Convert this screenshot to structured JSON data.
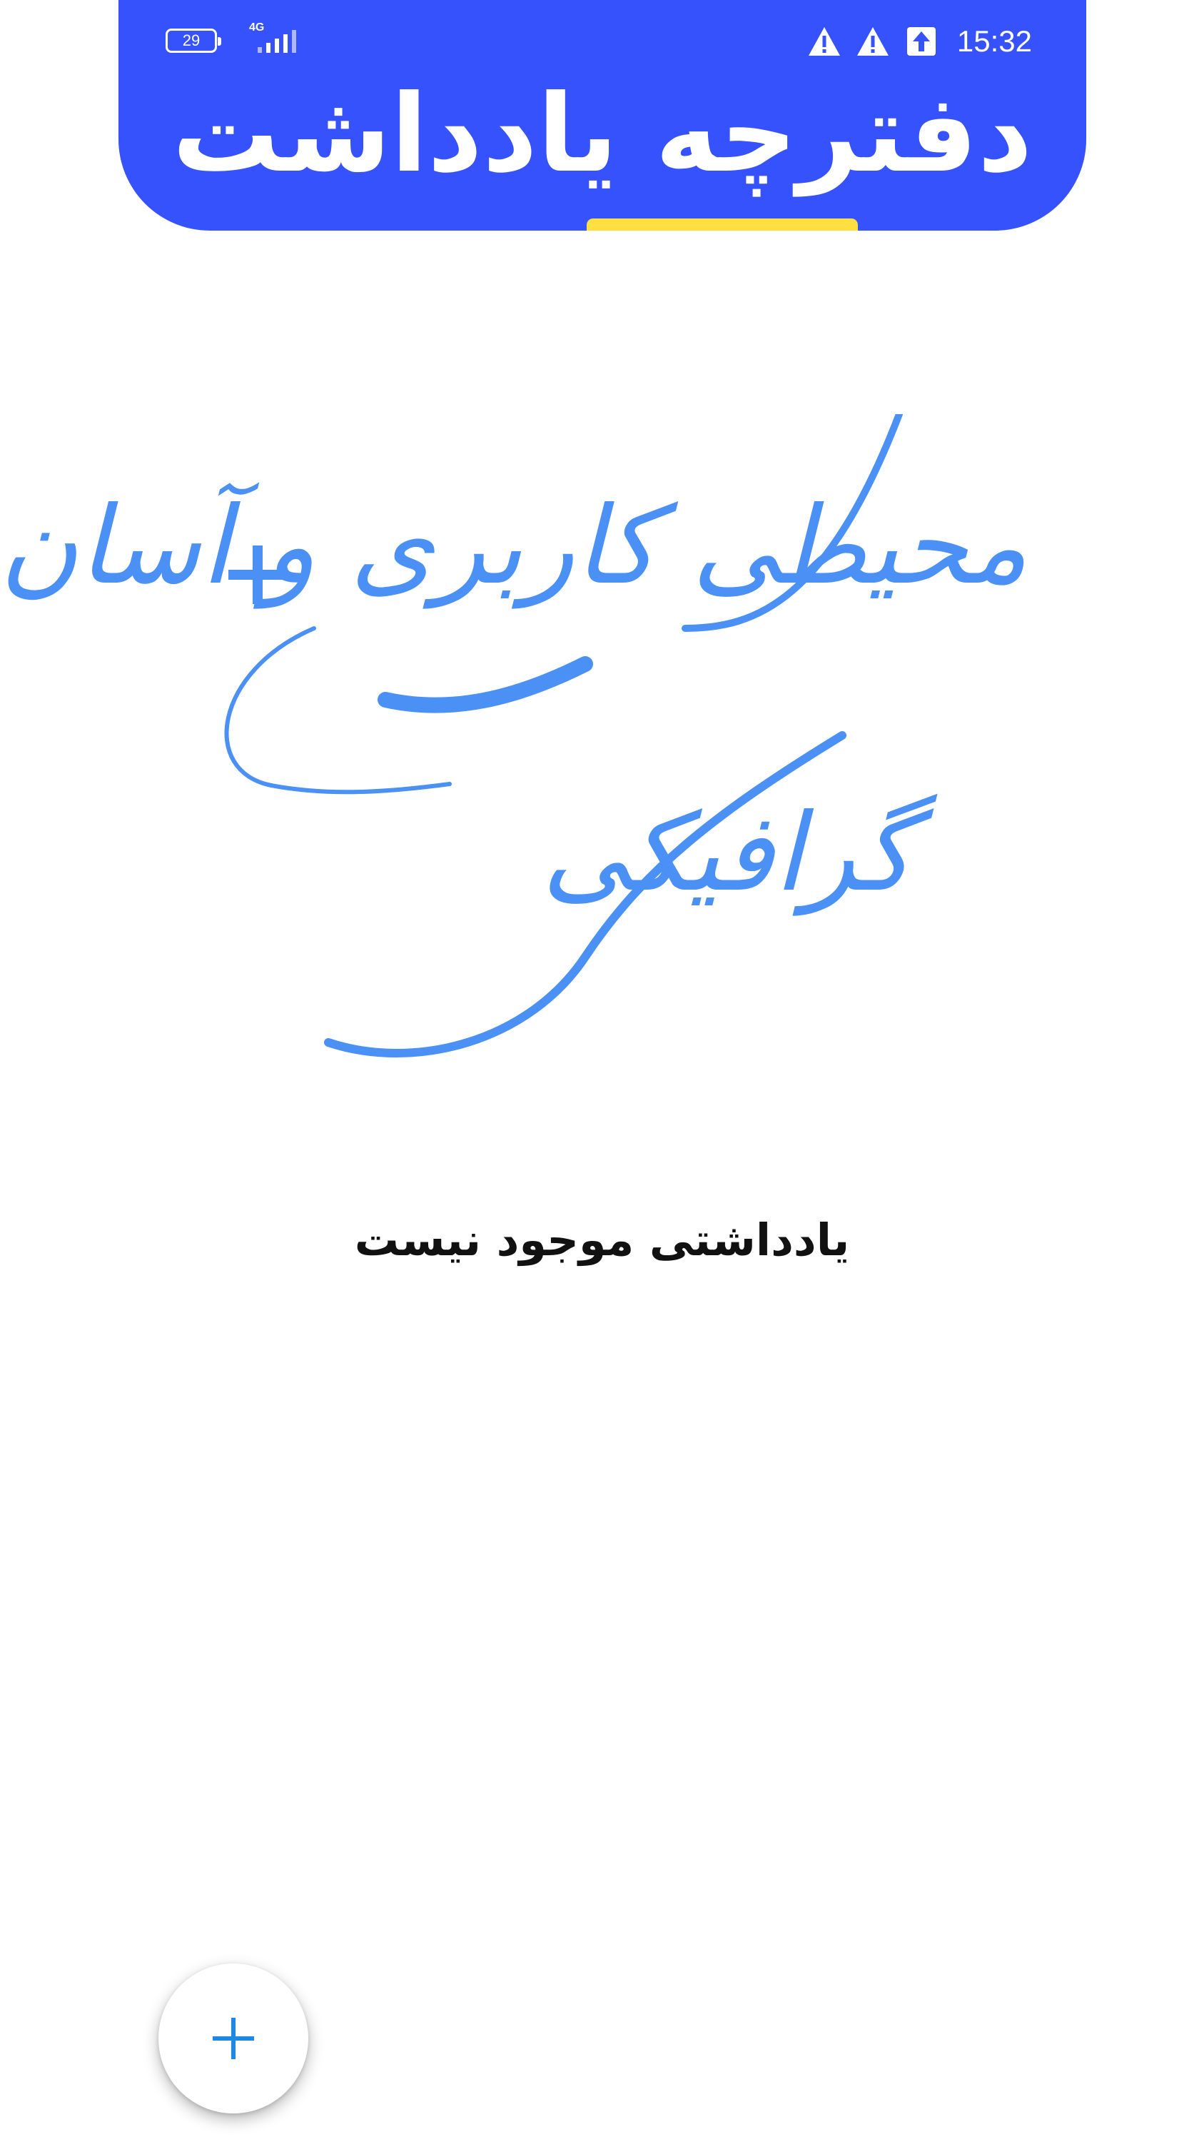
{
  "status_bar": {
    "battery": "29",
    "network": "4G",
    "time": "15:32",
    "icons": [
      "warning-icon",
      "warning-icon",
      "upload-icon"
    ]
  },
  "header": {
    "title": "دفترچه یادداشت"
  },
  "hero": {
    "line1": "محیطی کاربری و آسان",
    "line2": "گرافیکی",
    "plus": "+"
  },
  "empty_state": {
    "message": "یادداشتی موجود نیست"
  },
  "fab": {
    "icon": "plus-icon"
  },
  "colors": {
    "header_bg": "#3552fc",
    "accent": "#ffe040",
    "hero_text": "#4a90f5",
    "fab_icon": "#1e88e5"
  }
}
